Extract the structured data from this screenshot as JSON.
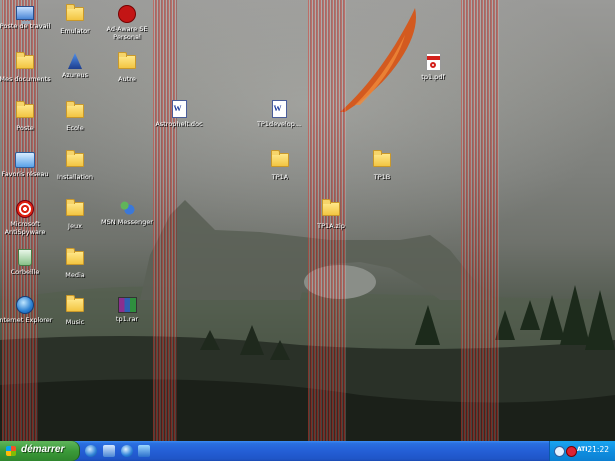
{
  "desktop": {
    "icons": [
      {
        "label": "Poste de travail",
        "icon": "computer-icon"
      },
      {
        "label": "Emulator",
        "icon": "folder-icon"
      },
      {
        "label": "Ad-Aware SE Personal",
        "icon": "ad-aware-icon"
      },
      {
        "label": "Mes documents",
        "icon": "documents-folder-icon"
      },
      {
        "label": "Azureus",
        "icon": "azureus-icon"
      },
      {
        "label": "Autre",
        "icon": "folder-icon"
      },
      {
        "label": "tp1.pdf",
        "icon": "pdf-icon"
      },
      {
        "label": "Poste",
        "icon": "folder-icon"
      },
      {
        "label": "Ecole",
        "icon": "folder-icon"
      },
      {
        "label": "Astrophelt.doc",
        "icon": "word-doc-icon"
      },
      {
        "label": "TP1develop...",
        "icon": "word-doc-icon"
      },
      {
        "label": "Favoris réseau",
        "icon": "network-icon"
      },
      {
        "label": "Installation",
        "icon": "folder-icon"
      },
      {
        "label": "TP1A",
        "icon": "folder-icon"
      },
      {
        "label": "TP1B",
        "icon": "folder-icon"
      },
      {
        "label": "Microsoft AntiSpyware",
        "icon": "antispyware-icon"
      },
      {
        "label": "Jeux",
        "icon": "folder-icon"
      },
      {
        "label": "MSN Messenger",
        "icon": "msn-messenger-icon"
      },
      {
        "label": "TP1A.zip",
        "icon": "zip-folder-icon"
      },
      {
        "label": "Corbeille",
        "icon": "recycle-bin-icon"
      },
      {
        "label": "Media",
        "icon": "folder-icon"
      },
      {
        "label": "Internet Explorer",
        "icon": "internet-explorer-icon"
      },
      {
        "label": "Music",
        "icon": "folder-icon"
      },
      {
        "label": "tp1.rar",
        "icon": "winrar-icon"
      }
    ]
  },
  "taskbar": {
    "start_label": "démarrer",
    "clock": "21:22",
    "quick_launch": [
      "internet-explorer-icon",
      "show-desktop-icon",
      "windows-media-icon",
      "messenger-icon"
    ],
    "tray_icons": [
      "security-icon",
      "antivirus-icon"
    ],
    "tray_label": "ATI"
  },
  "colors": {
    "taskbar_blue": "#245fd6",
    "start_green": "#3b9a39",
    "tray_blue": "#0f8ee0"
  }
}
